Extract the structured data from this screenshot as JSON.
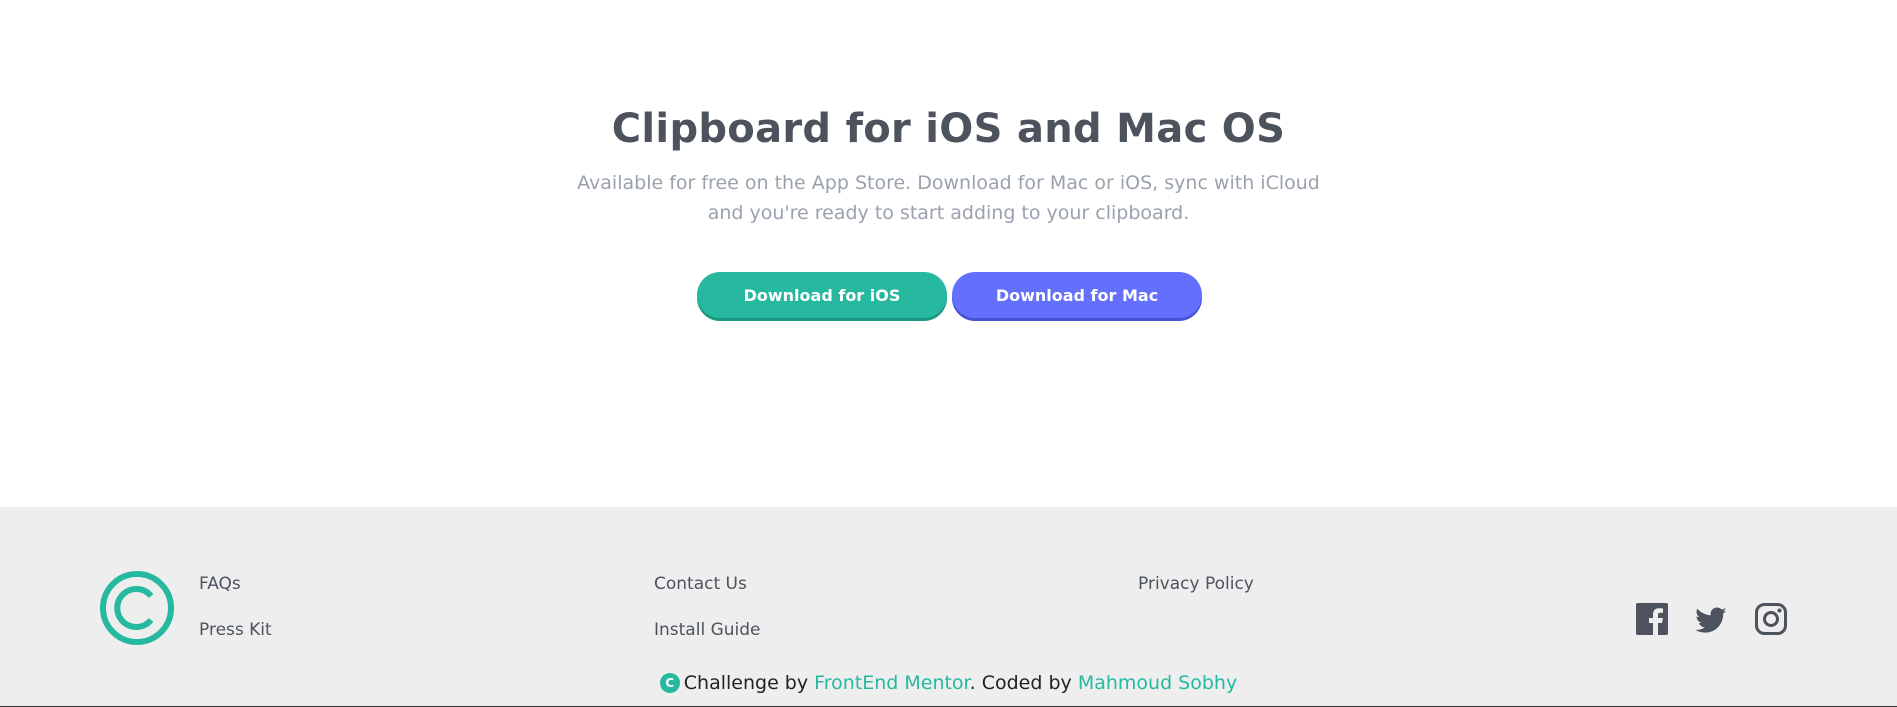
{
  "cta": {
    "title": "Clipboard for iOS and Mac OS",
    "description": "Available for free on the App Store. Download for Mac or iOS, sync with iCloud and you're ready to start adding to your clipboard.",
    "buttons": [
      {
        "label": "Download for iOS",
        "color": "#26b9a0"
      },
      {
        "label": "Download for Mac",
        "color": "#6370fe"
      }
    ]
  },
  "footer": {
    "logo_icon": "copyright-circle-icon",
    "links": [
      {
        "label": "FAQs"
      },
      {
        "label": "Press Kit"
      },
      {
        "label": "Contact Us"
      },
      {
        "label": "Install Guide"
      },
      {
        "label": "Privacy Policy"
      }
    ],
    "social": [
      "facebook-icon",
      "twitter-icon",
      "instagram-icon"
    ]
  },
  "attribution": {
    "icon_glyph": "C",
    "prefix": "Challenge by ",
    "challenge_link": "FrontEnd Mentor",
    "middle": ". Coded by ",
    "author_link": "Mahmoud Sobhy"
  },
  "colors": {
    "accent": "#26b9a0",
    "secondary": "#6370fe",
    "heading": "#4c535d",
    "muted": "#9aa2ad",
    "footer_bg": "#eeeeee"
  }
}
